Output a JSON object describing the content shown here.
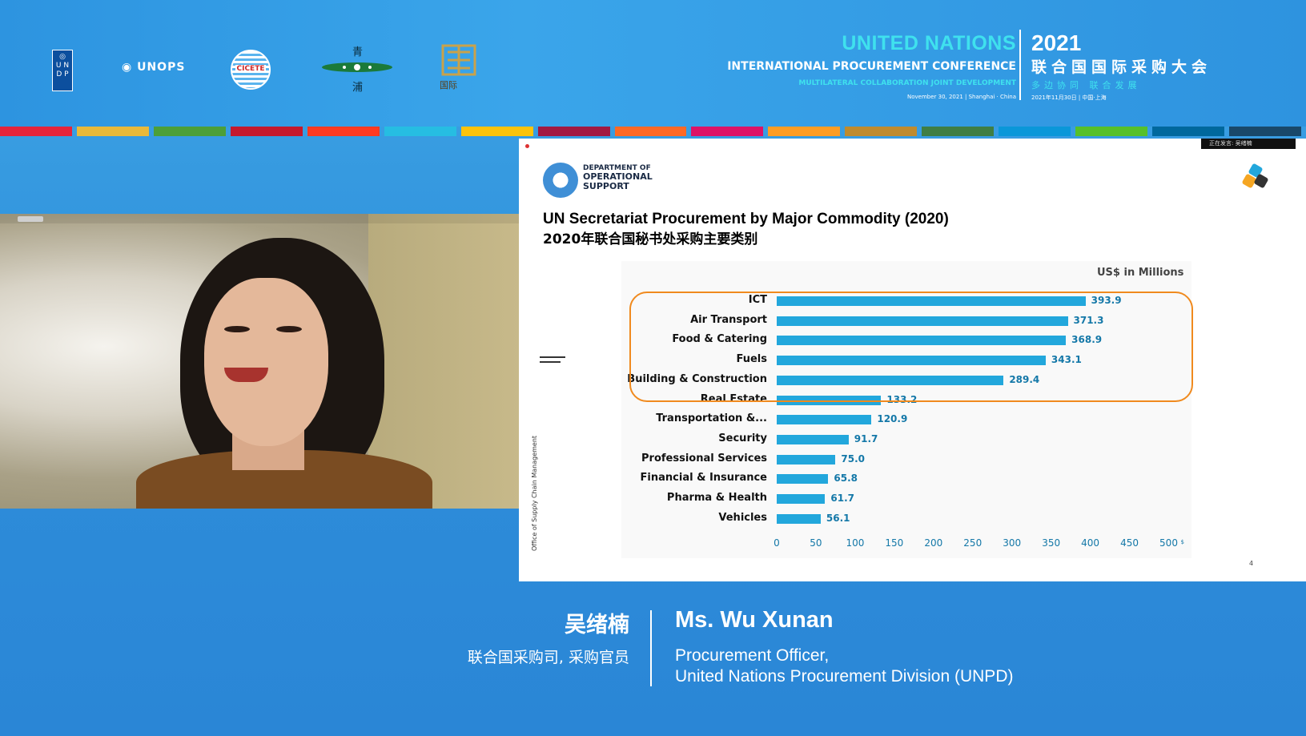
{
  "banner": {
    "logos": {
      "undp_text": "U N D P",
      "unops_text": "UNOPS",
      "cicete_text": "CICETE",
      "qingpu_text": "青浦",
      "eiis_text": "国际"
    },
    "conference": {
      "title_en": "UNITED NATIONS",
      "year": "2021",
      "name_en": "INTERNATIONAL PROCUREMENT CONFERENCE",
      "name_zh": "联合国国际采购大会",
      "tagline_en": "MULTILATERAL COLLABORATION   JOINT DEVELOPMENT",
      "tagline_zh": "多边协同 联合发展",
      "date_en": "November 30, 2021  |  Shanghai · China",
      "date_zh": "2021年11月30日 | 中国·上海"
    },
    "stripe_colors": [
      "#e5243b",
      "#e9b93a",
      "#4c9f38",
      "#c5192d",
      "#ff3a21",
      "#26bde2",
      "#fcc30b",
      "#a21942",
      "#fd6925",
      "#dd1367",
      "#fd9d24",
      "#bf8b2e",
      "#3f7e44",
      "#0a97d9",
      "#56c02b",
      "#00689d",
      "#19486a"
    ]
  },
  "slide": {
    "header_status": "正在发言: 吴绪楠",
    "department": [
      "DEPARTMENT OF",
      "OPERATIONAL",
      "SUPPORT"
    ],
    "title_en": "UN Secretariat Procurement by Major Commodity (2020)",
    "title_zh": "2020年联合国秘书处采购主要类别",
    "side_label": "Office of Supply Chain Management",
    "page_number": "4"
  },
  "chart_data": {
    "type": "bar",
    "orientation": "horizontal",
    "unit_label": "US$ in Millions",
    "categories": [
      "ICT",
      "Air Transport",
      "Food & Catering",
      "Fuels",
      "Building & Construction",
      "Real Estate",
      "Transportation &...",
      "Security",
      "Professional Services",
      "Financial & Insurance",
      "Pharma & Health",
      "Vehicles"
    ],
    "values": [
      393.9,
      371.3,
      368.9,
      343.1,
      289.4,
      133.2,
      120.9,
      91.7,
      75.0,
      65.8,
      61.7,
      56.1
    ],
    "value_labels": [
      "393.9",
      "371.3",
      "368.9",
      "343.1",
      "289.4",
      "133.2",
      "120.9",
      "91.7",
      "75.0",
      "65.8",
      "61.7",
      "56.1"
    ],
    "xlim": [
      0,
      500
    ],
    "x_ticks": [
      "0",
      "50",
      "100",
      "150",
      "200",
      "250",
      "300",
      "350",
      "400",
      "450",
      "500"
    ],
    "x_tick_suffix": "$",
    "bar_color": "#22a7dc",
    "highlight_color": "#f08a1e",
    "highlighted_categories": [
      "ICT",
      "Air Transport",
      "Food & Catering",
      "Fuels",
      "Building & Construction",
      "Real Estate"
    ]
  },
  "caption": {
    "name_zh": "吴绪楠",
    "role_zh": "联合国采购司, 采购官员",
    "name_en": "Ms. Wu Xunan",
    "role_en_line1": "Procurement Officer,",
    "role_en_line2": "United Nations Procurement Division (UNPD)"
  }
}
